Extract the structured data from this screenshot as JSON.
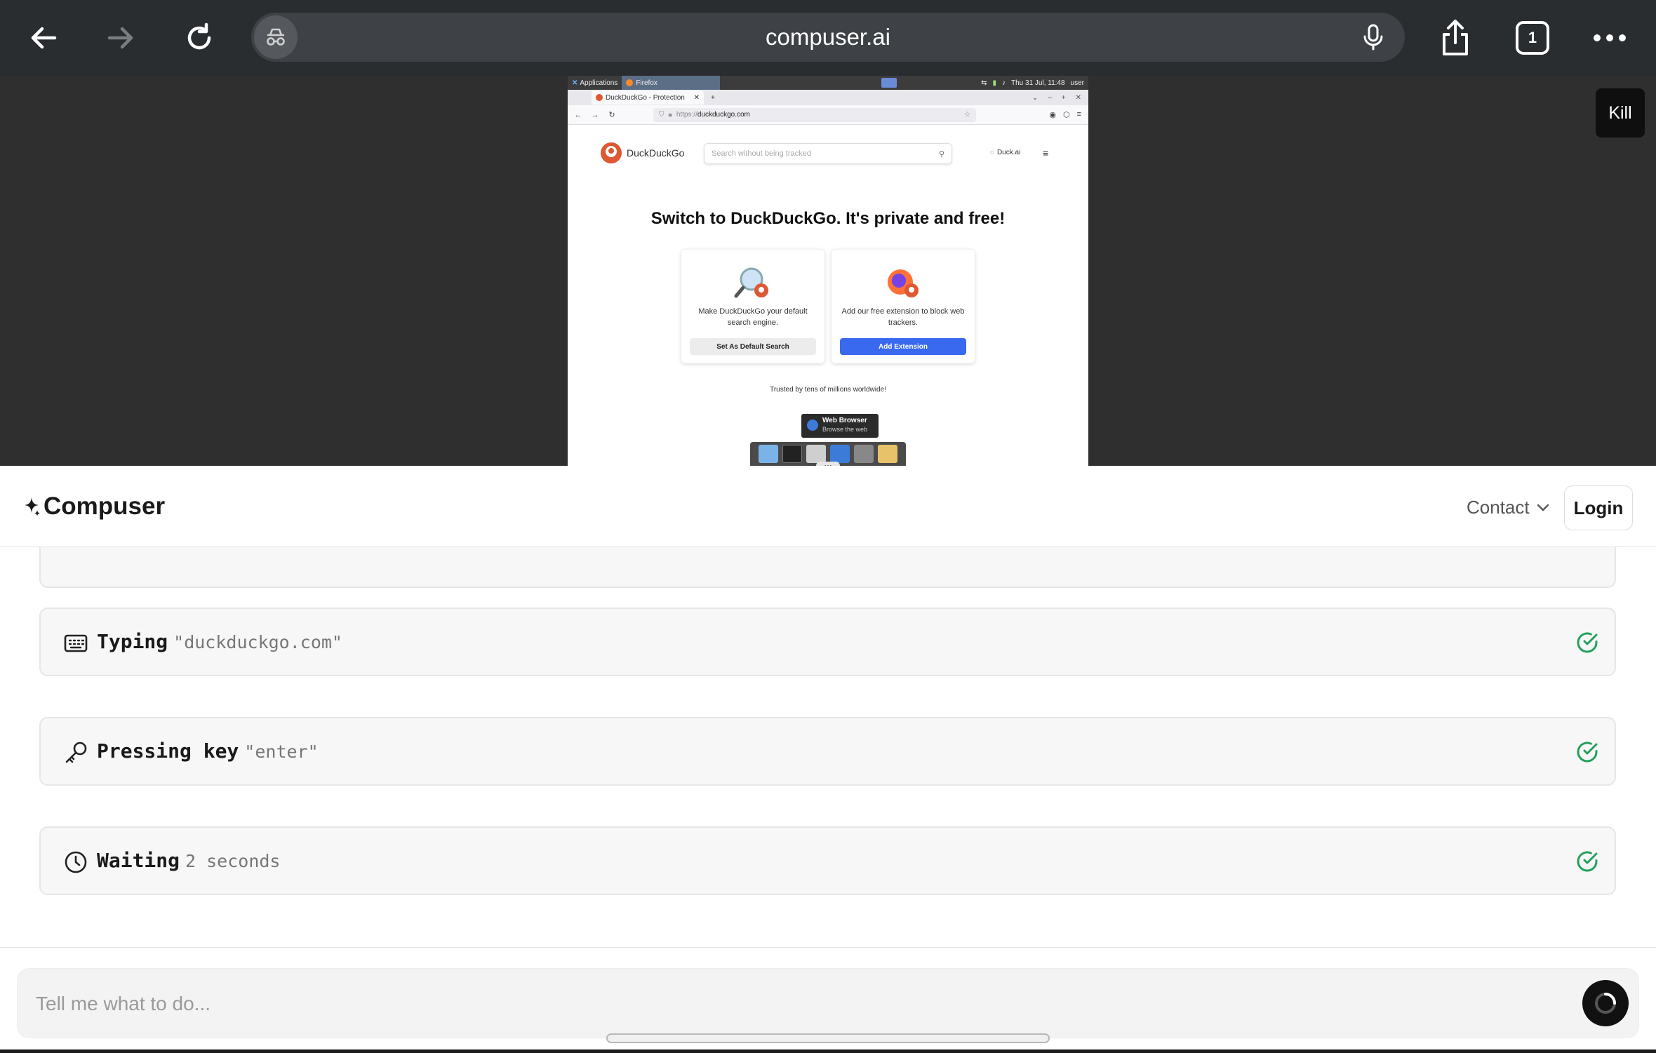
{
  "browser": {
    "url": "compuser.ai",
    "tab_count": "1",
    "icons": [
      "back-arrow-icon",
      "forward-arrow-icon",
      "reload-icon",
      "incognito-icon",
      "microphone-icon",
      "share-icon",
      "tabs-icon",
      "more-icon"
    ]
  },
  "viewer": {
    "kill_label": "Kill",
    "desktop": {
      "panel_apps": "Applications",
      "panel_task": "Firefox",
      "panel_clock": "Thu 31 Jul, 11:48",
      "panel_user": "user",
      "tab_title": "DuckDuckGo - Protection",
      "address_prefix": "https://",
      "address_domain": "duckduckgo.com",
      "ddg_brand": "DuckDuckGo",
      "search_placeholder": "Search without being tracked",
      "duck_ai": "Duck.ai",
      "hero": "Switch to DuckDuckGo. It's private and free!",
      "cards": [
        {
          "text": "Make DuckDuckGo your default search engine.",
          "button": "Set As Default Search"
        },
        {
          "text": "Add our free extension to block web trackers.",
          "button": "Add Extension"
        }
      ],
      "trusted": "Trusted by tens of millions worldwide!",
      "tooltip_title": "Web Browser",
      "tooltip_sub": "Browse the web"
    }
  },
  "app": {
    "brand": "Compuser",
    "contact_label": "Contact",
    "login_label": "Login"
  },
  "steps": [
    {
      "icon": "keyboard-icon",
      "action": "Typing",
      "value": "\"duckduckgo.com\"",
      "status": "done"
    },
    {
      "icon": "key-icon",
      "action": "Pressing key",
      "value": "\"enter\"",
      "status": "done"
    },
    {
      "icon": "clock-icon",
      "action": "Waiting",
      "value": "2 seconds",
      "status": "done"
    }
  ],
  "composer": {
    "placeholder": "Tell me what to do..."
  },
  "colors": {
    "chrome_bg": "#2a2d30",
    "viewer_bg": "#2f2f2f",
    "success_green": "#22a05a",
    "ddg_blue": "#3969ef"
  }
}
